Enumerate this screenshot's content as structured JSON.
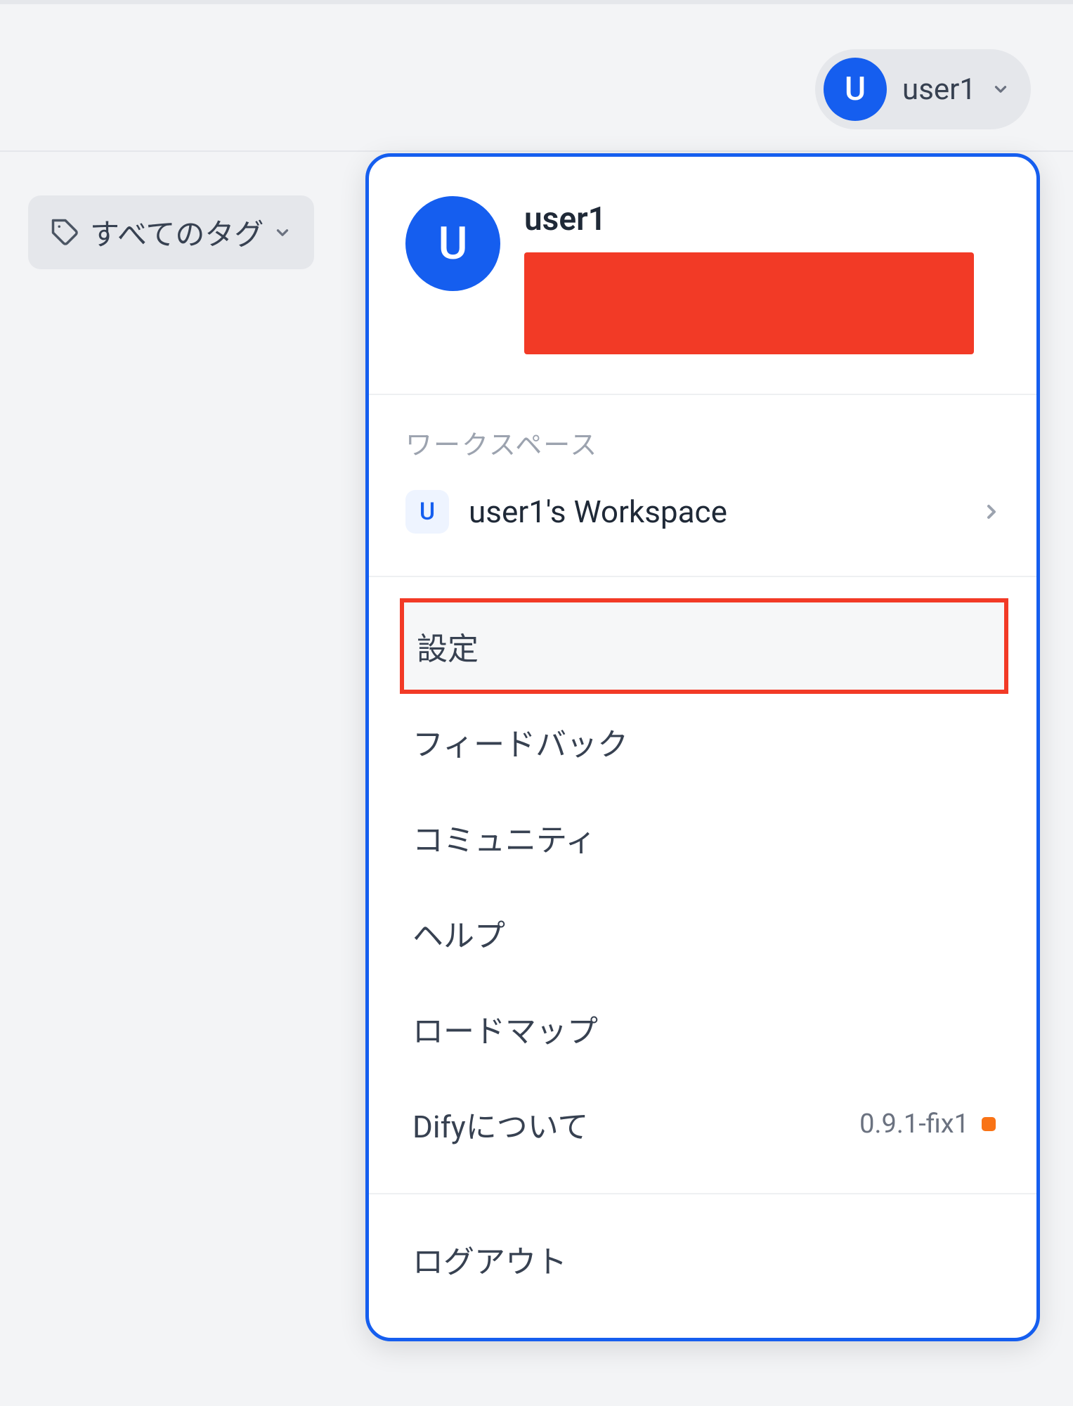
{
  "header": {
    "user_initial": "U",
    "username": "user1"
  },
  "tags_filter": {
    "label": "すべてのタグ"
  },
  "dropdown": {
    "avatar_initial": "U",
    "username": "user1",
    "workspace_label": "ワークスペース",
    "workspace": {
      "avatar_initial": "U",
      "name": "user1's Workspace"
    },
    "items": {
      "settings": "設定",
      "feedback": "フィードバック",
      "community": "コミュニティ",
      "help": "ヘルプ",
      "roadmap": "ロードマップ",
      "about": "Difyについて"
    },
    "version": "0.9.1-fix1",
    "logout": "ログアウト"
  }
}
